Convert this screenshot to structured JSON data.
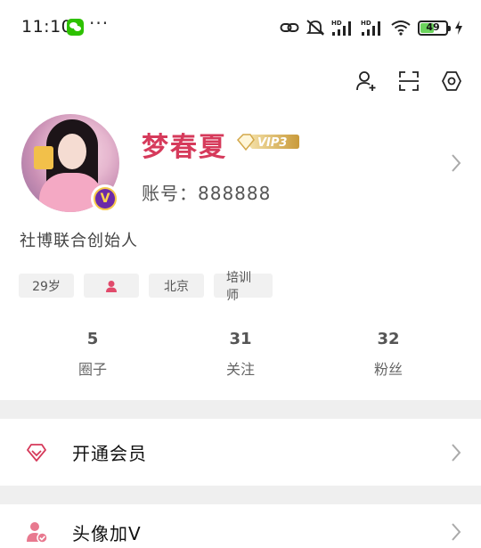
{
  "status_bar": {
    "time": "11:10",
    "battery": "49",
    "icons": [
      "wechat-icon",
      "more-dots-icon",
      "link-icon",
      "mute-icon",
      "hd-signal-icon",
      "hd-signal-icon",
      "wifi-icon",
      "battery-icon",
      "charging-icon"
    ],
    "more": "···",
    "hd": "HD"
  },
  "header": {
    "icons": [
      "add-friend-icon",
      "scan-icon",
      "settings-icon"
    ]
  },
  "profile": {
    "name": "梦春夏",
    "vip_label": "VIP3",
    "account_label": "账号：888888",
    "verified_badge": "V",
    "bio": "社博联合创始人",
    "tags": {
      "age": "29岁",
      "city": "北京",
      "job": "培训师"
    },
    "name_color": "#d63a5b"
  },
  "stats": [
    {
      "value": "5",
      "label": "圈子"
    },
    {
      "value": "31",
      "label": "关注"
    },
    {
      "value": "32",
      "label": "粉丝"
    }
  ],
  "menu": [
    {
      "label": "开通会员",
      "icon": "diamond-icon"
    },
    {
      "label": "头像加V",
      "icon": "user-verified-icon"
    }
  ]
}
